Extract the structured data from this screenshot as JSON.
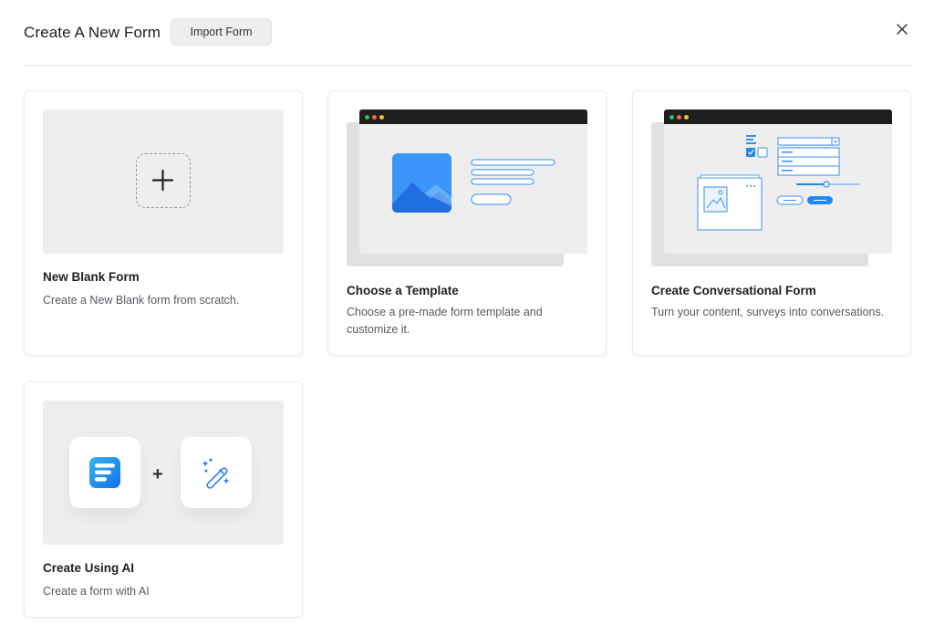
{
  "header": {
    "title": "Create A New Form",
    "import_label": "Import Form"
  },
  "cards": [
    {
      "title": "New Blank Form",
      "description": "Create a New Blank form from scratch."
    },
    {
      "title": "Choose a Template",
      "description": "Choose a pre-made form template and customize it."
    },
    {
      "title": "Create Conversational Form",
      "description": "Turn your content, surveys into conversations."
    },
    {
      "title": "Create Using AI",
      "description": "Create a form with AI"
    }
  ],
  "colors": {
    "accent": "#1e88f5",
    "dot_red": "#ff5f57",
    "dot_yellow": "#febc2e",
    "dot_green": "#28c840"
  },
  "icons": [
    "close-icon",
    "plus-icon",
    "image-icon",
    "fluent-forms-logo-icon",
    "magic-wand-icon"
  ]
}
